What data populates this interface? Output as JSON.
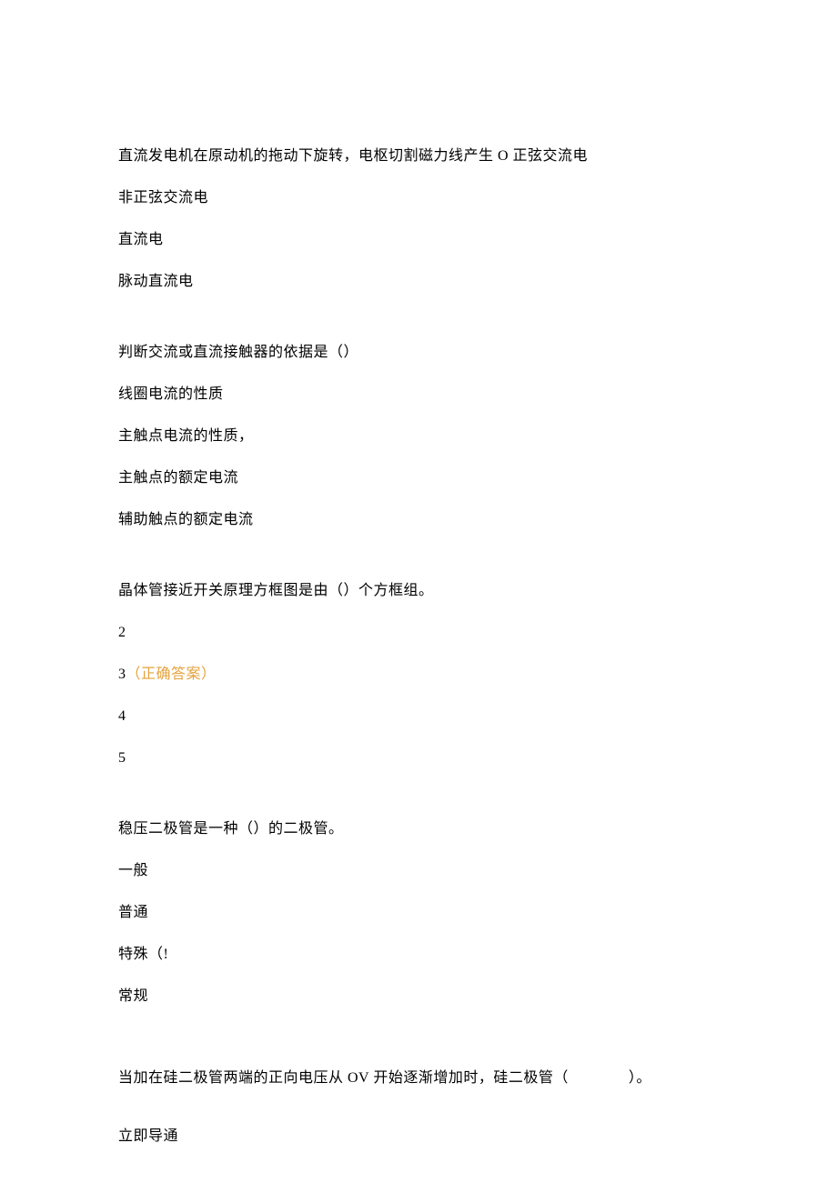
{
  "q1": {
    "stem": "直流发电机在原动机的拖动下旋转，电枢切割磁力线产生 O 正弦交流电",
    "opts": [
      "非正弦交流电",
      "直流电",
      "脉动直流电"
    ]
  },
  "q2": {
    "stem": "判断交流或直流接触器的依据是（）",
    "opts": [
      "线圈电流的性质",
      "主触点电流的性质，",
      "主触点的额定电流",
      "辅助触点的额定电流"
    ]
  },
  "q3": {
    "stem": "晶体管接近开关原理方框图是由（）个方框组。",
    "opts": [
      "2",
      "3",
      "4",
      "5"
    ],
    "correct_label": "（正确答案）"
  },
  "q4": {
    "stem": "稳压二极管是一种（）的二极管。",
    "opts": [
      "一般",
      "普通",
      "特殊（!",
      "常规"
    ]
  },
  "q5": {
    "stem": "当加在硅二极管两端的正向电压从 OV 开始逐渐增加时，硅二极管（　　　　）。",
    "opts": [
      "立即导通"
    ]
  }
}
